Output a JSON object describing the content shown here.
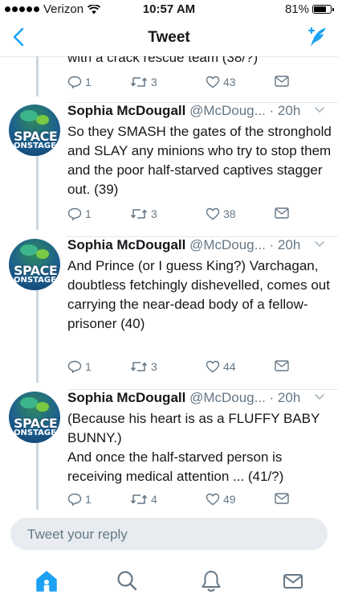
{
  "status_bar": {
    "carrier": "Verizon",
    "time": "10:57 AM",
    "battery": "81%",
    "battery_level": 0.81
  },
  "nav": {
    "title": "Tweet",
    "back_icon": "chevron-left-icon",
    "compose_icon": "compose-tweet-icon"
  },
  "previous_tweet": {
    "fragment_text": "with a crack rescue team (38/?)",
    "replies": "1",
    "retweets": "3",
    "likes": "43"
  },
  "tweets": [
    {
      "name": "Sophia McDougall",
      "handle": "@McDoug...",
      "time": "· 20h",
      "text": "So they SMASH the gates of the stronghold and SLAY any minions who try to stop them and the poor half-starved captives stagger out. (39)",
      "replies": "1",
      "retweets": "3",
      "likes": "38",
      "avatar_top": "SPACE",
      "avatar_bottom": "ONSTAGE"
    },
    {
      "name": "Sophia McDougall",
      "handle": "@McDoug...",
      "time": "· 20h",
      "text": "And Prince (or I guess King?) Varchagan, doubtless fetchingly dishevelled, comes out carrying the near-dead body of a fellow-prisoner (40)",
      "replies": "1",
      "retweets": "3",
      "likes": "44",
      "avatar_top": "SPACE",
      "avatar_bottom": "ONSTAGE"
    },
    {
      "name": "Sophia McDougall",
      "handle": "@McDoug...",
      "time": "· 20h",
      "text_line1": "(Because his heart is as a FLUFFY BABY BUNNY.)",
      "text_line2": "And once the half-starved person is receiving medical attention ... (41/?)",
      "replies": "1",
      "retweets": "4",
      "likes": "49",
      "avatar_top": "SPACE",
      "avatar_bottom": "ONSTAGE"
    }
  ],
  "reply": {
    "placeholder": "Tweet your reply"
  },
  "tab_bar": {
    "items": [
      "home-icon",
      "search-icon",
      "notifications-icon",
      "messages-icon"
    ]
  },
  "colors": {
    "accent": "#1da1f2",
    "muted": "#657786",
    "divider": "#e1e8ed"
  }
}
